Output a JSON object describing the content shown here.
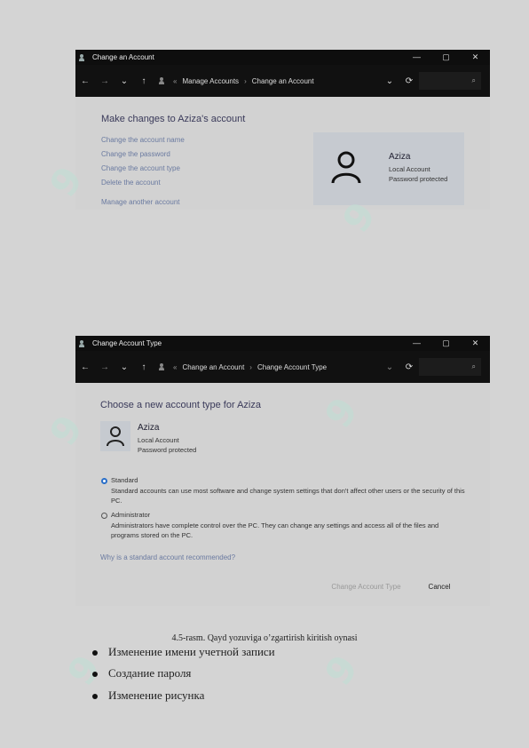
{
  "window1": {
    "title": "Change an Account",
    "controls": [
      "—",
      "▢",
      "✕"
    ],
    "breadcrumb": [
      "Manage Accounts",
      "Change an Account"
    ],
    "heading": "Make changes to Aziza's account",
    "links": [
      "Change the account name",
      "Change the password",
      "Change the account type",
      "Delete the account",
      "Manage another account"
    ],
    "user": {
      "name": "Aziza",
      "type": "Local Account",
      "status": "Password protected"
    }
  },
  "window2": {
    "title": "Change Account Type",
    "controls": [
      "—",
      "▢",
      "✕"
    ],
    "breadcrumb": [
      "Change an Account",
      "Change Account Type"
    ],
    "heading": "Choose a new account type for Aziza",
    "user": {
      "name": "Aziza",
      "type": "Local Account",
      "status": "Password protected"
    },
    "options": [
      {
        "label": "Standard",
        "selected": true,
        "description": "Standard accounts can use most software and change system settings that don't affect other users or the security of this PC."
      },
      {
        "label": "Administrator",
        "selected": false,
        "description": "Administrators have complete control over the PC. They can change any settings and access all of the files and programs stored on the PC."
      }
    ],
    "why_link": "Why is a standard account recommended?",
    "change_button": "Change Account Type",
    "cancel_button": "Cancel"
  },
  "caption": "4.5-rasm. Qayd yozuviga o’zgartirish kiritish oynasi",
  "bullets": [
    "Изменение имени учетной записи",
    "Создание пароля",
    "Изменение рисунка"
  ],
  "colors": {
    "link": "#6a7aa0",
    "accent": "#2a6fc9",
    "titlebar": "#0e0e0e"
  }
}
